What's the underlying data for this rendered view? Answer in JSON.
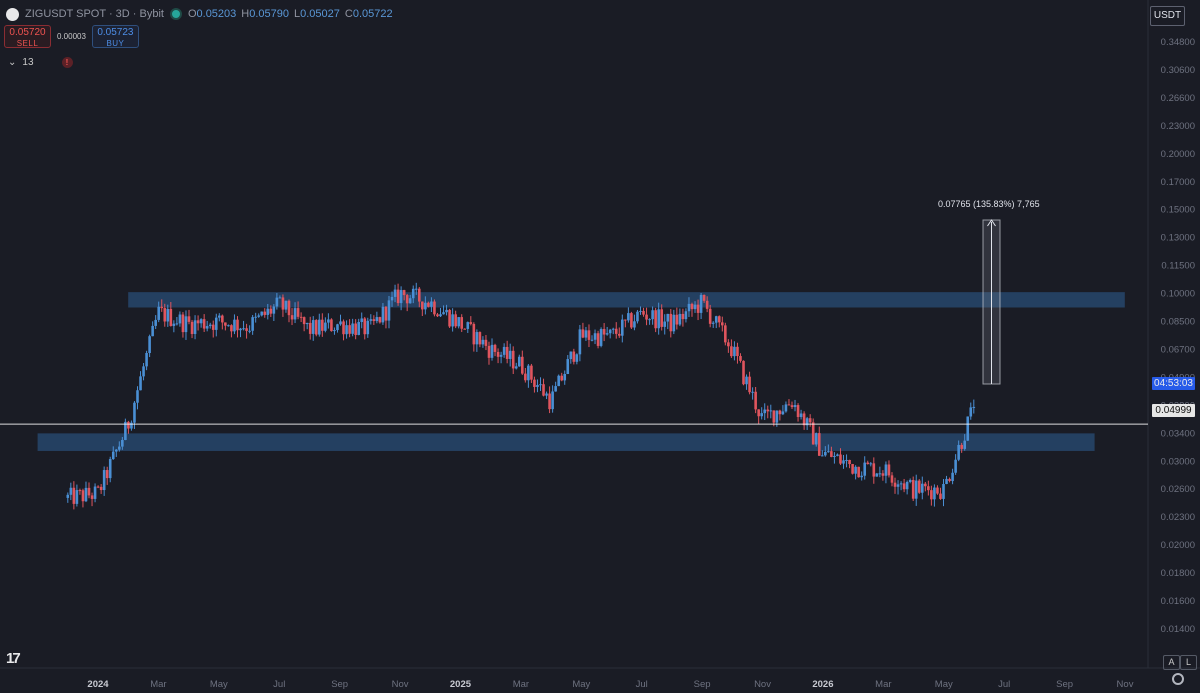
{
  "header": {
    "title": "ZIGUSDT SPOT · 3D · Bybit",
    "ohlc": [
      {
        "key": "O",
        "value": "0.05203"
      },
      {
        "key": "H",
        "value": "0.05790"
      },
      {
        "key": "L",
        "value": "0.05027"
      },
      {
        "key": "C",
        "value": "0.05722"
      }
    ]
  },
  "trade": {
    "sell_price": "0.05720",
    "sell_label": "SELL",
    "spread": "0.00003",
    "buy_price": "0.05723",
    "buy_label": "BUY"
  },
  "indicators": {
    "count": "13",
    "toggle_icon": "chevron-down-icon",
    "warning_icon": "warning-icon",
    "warning_text": "!"
  },
  "currency": "USDT",
  "price_tags": {
    "countdown": "04:53:03",
    "current": "0.04999"
  },
  "measure": {
    "label": "0.07765 (135.83%) 7,765"
  },
  "brand": {
    "logo": "TradingView",
    "logo_text": "17"
  },
  "controls": {
    "auto": "A",
    "log": "L",
    "settings_icon": "gear-icon"
  },
  "colors": {
    "up": "#4a8fd4",
    "down": "#e0555e",
    "zone": "#2d5f93",
    "background": "#1a1c25"
  },
  "chart_data": {
    "type": "candlestick",
    "scale": "log",
    "x_ticks": [
      "2024",
      "Mar",
      "May",
      "Jul",
      "Sep",
      "Nov",
      "2025",
      "Mar",
      "May",
      "Jul",
      "Sep",
      "Nov",
      "2026",
      "Mar",
      "May",
      "Jul",
      "Sep",
      "Nov"
    ],
    "y_ticks": [
      "0.34800",
      "0.30600",
      "0.26600",
      "0.23000",
      "0.20000",
      "0.17000",
      "0.15000",
      "0.13000",
      "0.11500",
      "0.10000",
      "0.08500",
      "0.06700",
      "0.04900",
      "0.03800",
      "0.03400",
      "0.03000",
      "0.02600",
      "0.02300",
      "0.02000",
      "0.01800",
      "0.01600",
      "0.01400"
    ],
    "ylim": [
      0.0135,
      0.37
    ],
    "current_price": 0.04999,
    "zones": [
      {
        "name": "resistance",
        "from": "Feb 2024",
        "to": "Nov 2026",
        "low": 0.125,
        "high": 0.141
      },
      {
        "name": "support",
        "from": "Nov 2023",
        "to": "Oct 2026",
        "low": 0.0405,
        "high": 0.0465
      }
    ],
    "close_path": [
      [
        "Dec 2023",
        0.028
      ],
      [
        "Jan 2024",
        0.029
      ],
      [
        "Feb 2024",
        0.05
      ],
      [
        "Mar 2024",
        0.12
      ],
      [
        "Apr 2024",
        0.11
      ],
      [
        "May 2024",
        0.112
      ],
      [
        "Jun 2024",
        0.108
      ],
      [
        "Jul 2024",
        0.128
      ],
      [
        "Aug 2024",
        0.105
      ],
      [
        "Sep 2024",
        0.11
      ],
      [
        "Oct 2024",
        0.105
      ],
      [
        "Nov 2024",
        0.14
      ],
      [
        "Dec 2024",
        0.13
      ],
      [
        "Jan 2025",
        0.11
      ],
      [
        "Feb 2025",
        0.09
      ],
      [
        "Mar 2025",
        0.08
      ],
      [
        "Apr 2025",
        0.06
      ],
      [
        "May 2025",
        0.1
      ],
      [
        "Jun 2025",
        0.1
      ],
      [
        "Jul 2025",
        0.12
      ],
      [
        "Aug 2025",
        0.11
      ],
      [
        "Sep 2025",
        0.13
      ],
      [
        "Oct 2025",
        0.09
      ],
      [
        "Nov 2025",
        0.052
      ],
      [
        "Dec 2025",
        0.06
      ],
      [
        "Jan 2026",
        0.04
      ],
      [
        "Feb 2026",
        0.036
      ],
      [
        "Mar 2026",
        0.035
      ],
      [
        "Apr 2026",
        0.03
      ],
      [
        "May 2026",
        0.03
      ],
      [
        "Jun 2026",
        0.05722
      ]
    ]
  }
}
